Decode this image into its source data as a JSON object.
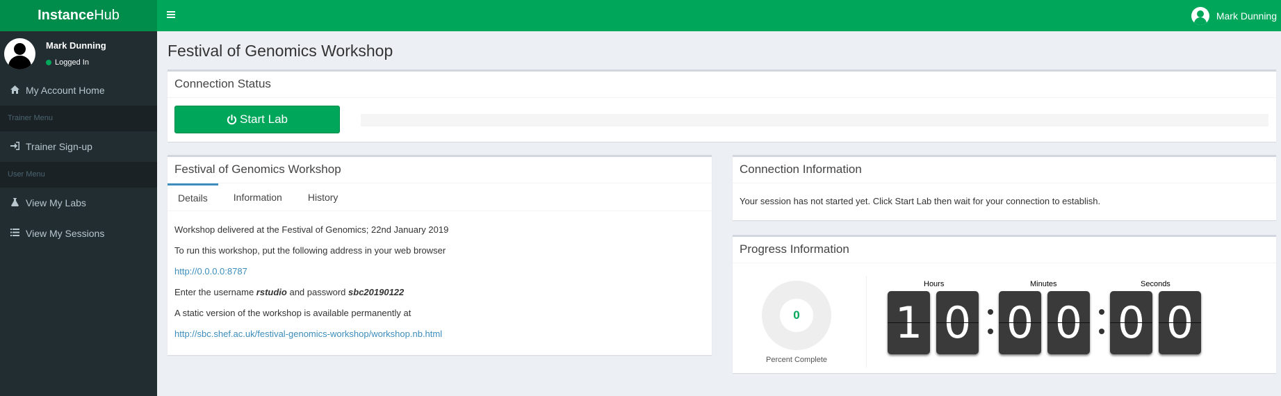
{
  "app": {
    "logo_bold": "Instance",
    "logo_rest": "Hub"
  },
  "header": {
    "user_name": "Mark Dunning"
  },
  "sidebar": {
    "user_name": "Mark Dunning",
    "status": "Logged In",
    "items": [
      {
        "label": "My Account Home",
        "icon": "home-icon"
      },
      {
        "header": "Trainer Menu"
      },
      {
        "label": "Trainer Sign-up",
        "icon": "sign-in-icon"
      },
      {
        "header": "User Menu"
      },
      {
        "label": "View My Labs",
        "icon": "flask-icon"
      },
      {
        "label": "View My Sessions",
        "icon": "list-icon"
      }
    ]
  },
  "page": {
    "title": "Festival of Genomics Workshop"
  },
  "connection_status": {
    "title": "Connection Status",
    "start_label": "Start Lab",
    "progress": 0
  },
  "workshop": {
    "title": "Festival of Genomics Workshop",
    "tabs": [
      "Details",
      "Information",
      "History"
    ],
    "active_tab": "Details",
    "line1": "Workshop delivered at the Festival of Genomics; 22nd January 2019",
    "line2": "To run this workshop, put the following address in your web browser",
    "link1": "http://0.0.0.0:8787",
    "line3_pre": "Enter the username ",
    "username": "rstudio",
    "line3_mid": " and password ",
    "password": "sbc20190122",
    "line4": "A static version of the workshop is available permanently at",
    "link2": "http://sbc.shef.ac.uk/festival-genomics-workshop/workshop.nb.html"
  },
  "connection_info": {
    "title": "Connection Information",
    "text": "Your session has not started yet. Click Start Lab then wait for your connection to establish."
  },
  "progress_info": {
    "title": "Progress Information",
    "percent": "0",
    "percent_label": "Percent Complete",
    "countdown": {
      "hours_label": "Hours",
      "minutes_label": "Minutes",
      "seconds_label": "Seconds",
      "h1": "1",
      "h2": "0",
      "m1": "0",
      "m2": "0",
      "s1": "0",
      "s2": "0"
    }
  },
  "colors": {
    "brand": "#00a65a",
    "brand_dark": "#008d4c",
    "sidebar": "#222d32",
    "link": "#3c8dbc"
  }
}
